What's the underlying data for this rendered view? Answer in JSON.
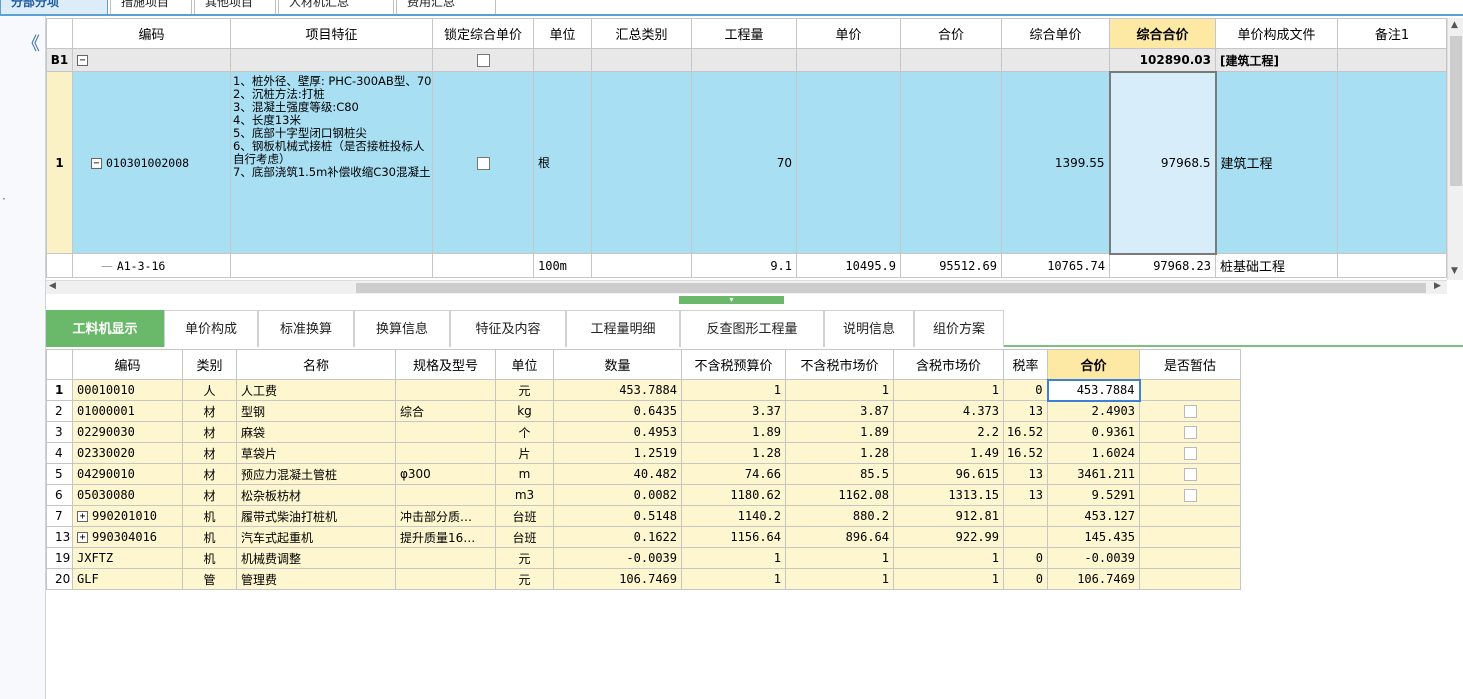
{
  "top_tabs": [
    {
      "label": "分部分项"
    },
    {
      "label": "措施项目"
    },
    {
      "label": "其他项目"
    },
    {
      "label": "人材机汇总"
    },
    {
      "label": "费用汇总"
    }
  ],
  "nav": {
    "collapse_glyph": "《",
    "gutter_glyph": "·"
  },
  "upper": {
    "columns": [
      "编码",
      "项目特征",
      "锁定综合单价",
      "单位",
      "汇总类别",
      "工程量",
      "单价",
      "合价",
      "综合单价",
      "综合合价",
      "单价构成文件",
      "备注1"
    ],
    "b1": {
      "index": "B1",
      "total": "102890.03",
      "label": "[建筑工程]"
    },
    "row1": {
      "index": "1",
      "code": "010301002008",
      "features": "1、桩外径、壁厚: PHC-300AB型、70\n2、沉桩方法:打桩\n3、混凝土强度等级:C80\n4、长度13米\n5、底部十字型闭口钢桩尖\n6、钢板机械式接桩（是否接桩投标人自行考虑）\n7、底部浇筑1.5m补偿收缩C30混凝土",
      "unit": "根",
      "quantity": "70",
      "composite_unit_price": "1399.55",
      "composite_total": "97968.5",
      "price_file": "建筑工程"
    },
    "rowA1": {
      "code": "A1-3-16",
      "unit": "100m",
      "quantity": "9.1",
      "unit_price": "10495.9",
      "total": "95512.69",
      "composite_unit_price": "10765.74",
      "composite_total": "97968.23",
      "price_file": "桩基础工程"
    }
  },
  "bottom_tabs": [
    {
      "label": "工料机显示"
    },
    {
      "label": "单价构成"
    },
    {
      "label": "标准换算"
    },
    {
      "label": "换算信息"
    },
    {
      "label": "特征及内容"
    },
    {
      "label": "工程量明细"
    },
    {
      "label": "反查图形工程量"
    },
    {
      "label": "说明信息"
    },
    {
      "label": "组价方案"
    }
  ],
  "lower": {
    "columns": [
      "编码",
      "类别",
      "名称",
      "规格及型号",
      "单位",
      "数量",
      "不含税预算价",
      "不含税市场价",
      "含税市场价",
      "税率",
      "合价",
      "是否暂估"
    ],
    "rows": [
      {
        "idx": "1",
        "code": "00010010",
        "cat": "人",
        "name": "人工费",
        "spec": "",
        "unit": "元",
        "qty": "453.7884",
        "budget": "1",
        "market": "1",
        "tax_market": "1",
        "rate": "0",
        "total": "453.7884",
        "check": false,
        "expand": false
      },
      {
        "idx": "2",
        "code": "01000001",
        "cat": "材",
        "name": "型钢",
        "spec": "综合",
        "unit": "kg",
        "qty": "0.6435",
        "budget": "3.37",
        "market": "3.87",
        "tax_market": "4.373",
        "rate": "13",
        "total": "2.4903",
        "check": true,
        "expand": false
      },
      {
        "idx": "3",
        "code": "02290030",
        "cat": "材",
        "name": "麻袋",
        "spec": "",
        "unit": "个",
        "qty": "0.4953",
        "budget": "1.89",
        "market": "1.89",
        "tax_market": "2.2",
        "rate": "16.52",
        "total": "0.9361",
        "check": true,
        "expand": false
      },
      {
        "idx": "4",
        "code": "02330020",
        "cat": "材",
        "name": "草袋片",
        "spec": "",
        "unit": "片",
        "qty": "1.2519",
        "budget": "1.28",
        "market": "1.28",
        "tax_market": "1.49",
        "rate": "16.52",
        "total": "1.6024",
        "check": true,
        "expand": false
      },
      {
        "idx": "5",
        "code": "04290010",
        "cat": "材",
        "name": "预应力混凝土管桩",
        "spec": "φ300",
        "unit": "m",
        "qty": "40.482",
        "budget": "74.66",
        "market": "85.5",
        "tax_market": "96.615",
        "rate": "13",
        "total": "3461.211",
        "check": true,
        "expand": false
      },
      {
        "idx": "6",
        "code": "05030080",
        "cat": "材",
        "name": "松杂板枋材",
        "spec": "",
        "unit": "m3",
        "qty": "0.0082",
        "budget": "1180.62",
        "market": "1162.08",
        "tax_market": "1313.15",
        "rate": "13",
        "total": "9.5291",
        "check": true,
        "expand": false
      },
      {
        "idx": "7",
        "code": "990201010",
        "cat": "机",
        "name": "履带式柴油打桩机",
        "spec": "冲击部分质…",
        "unit": "台班",
        "qty": "0.5148",
        "budget": "1140.2",
        "market": "880.2",
        "tax_market": "912.81",
        "rate": "",
        "total": "453.127",
        "check": false,
        "expand": true
      },
      {
        "idx": "13",
        "code": "990304016",
        "cat": "机",
        "name": "汽车式起重机",
        "spec": "提升质量16…",
        "unit": "台班",
        "qty": "0.1622",
        "budget": "1156.64",
        "market": "896.64",
        "tax_market": "922.99",
        "rate": "",
        "total": "145.435",
        "check": false,
        "expand": true
      },
      {
        "idx": "19",
        "code": "JXFTZ",
        "cat": "机",
        "name": "机械费调整",
        "spec": "",
        "unit": "元",
        "qty": "-0.0039",
        "budget": "1",
        "market": "1",
        "tax_market": "1",
        "rate": "0",
        "total": "-0.0039",
        "check": false,
        "expand": false
      },
      {
        "idx": "20",
        "code": "GLF",
        "cat": "管",
        "name": "管理费",
        "spec": "",
        "unit": "元",
        "qty": "106.7469",
        "budget": "1",
        "market": "1",
        "tax_market": "1",
        "rate": "0",
        "total": "106.7469",
        "check": false,
        "expand": false
      }
    ]
  },
  "colors": {
    "accent_blue": "#5aa0d4",
    "row_highlight": "#a9dff3",
    "tab_green": "#6ab86a",
    "header_gold": "#fde9a4",
    "cell_yellow": "#fdf6cf"
  }
}
